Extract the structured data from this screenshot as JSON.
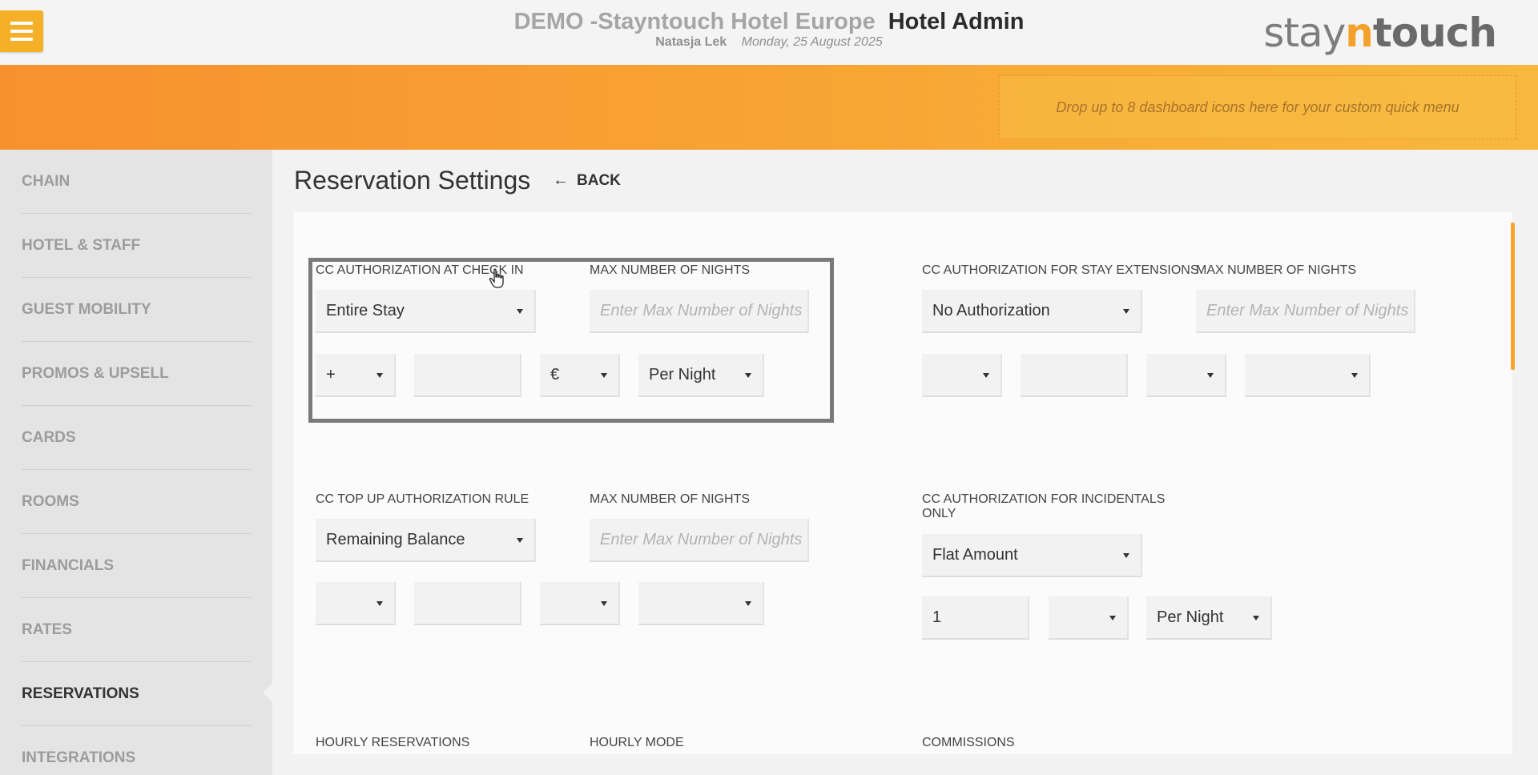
{
  "header": {
    "hotel_name": "DEMO -Stayntouch Hotel Europe",
    "app_name": "Hotel Admin",
    "user": "Natasja Lek",
    "date": "Monday, 25 August 2025",
    "logo_part1": "stay",
    "logo_part2": "n",
    "logo_part3": "touch"
  },
  "banner": {
    "dropzone_text": "Drop up to 8 dashboard icons here for your custom quick menu"
  },
  "sidebar": {
    "items": [
      {
        "label": "CHAIN"
      },
      {
        "label": "HOTEL & STAFF"
      },
      {
        "label": "GUEST MOBILITY"
      },
      {
        "label": "PROMOS & UPSELL"
      },
      {
        "label": "CARDS"
      },
      {
        "label": "ROOMS"
      },
      {
        "label": "FINANCIALS"
      },
      {
        "label": "RATES"
      },
      {
        "label": "RESERVATIONS"
      },
      {
        "label": "INTEGRATIONS"
      }
    ],
    "active": "RESERVATIONS"
  },
  "page": {
    "title": "Reservation Settings",
    "back_label": "BACK"
  },
  "form": {
    "cc_checkin": {
      "label": "CC AUTHORIZATION AT CHECK IN",
      "value": "Entire Stay",
      "max_nights_label": "MAX NUMBER OF NIGHTS",
      "max_nights_placeholder": "Enter Max Number of Nights",
      "operator": "+",
      "amount": "",
      "currency": "€",
      "period": "Per Night"
    },
    "cc_extensions": {
      "label": "CC AUTHORIZATION FOR STAY EXTENSIONS",
      "value": "No Authorization",
      "max_nights_label": "MAX NUMBER OF NIGHTS",
      "max_nights_placeholder": "Enter Max Number of Nights",
      "operator": "",
      "amount": "",
      "currency": "",
      "period": ""
    },
    "cc_topup": {
      "label": "CC TOP UP AUTHORIZATION RULE",
      "value": "Remaining Balance",
      "max_nights_label": "MAX NUMBER OF NIGHTS",
      "max_nights_placeholder": "Enter Max Number of Nights",
      "operator": "",
      "amount": "",
      "currency": "",
      "period": ""
    },
    "cc_incidentals": {
      "label_line1": "CC AUTHORIZATION FOR INCIDENTALS",
      "label_line2": "ONLY",
      "value": "Flat Amount",
      "amount": "1",
      "currency": "",
      "period": "Per Night"
    },
    "hourly_reservations_label": "HOURLY RESERVATIONS",
    "hourly_mode_label": "HOURLY MODE",
    "commissions_label": "COMMISSIONS"
  }
}
